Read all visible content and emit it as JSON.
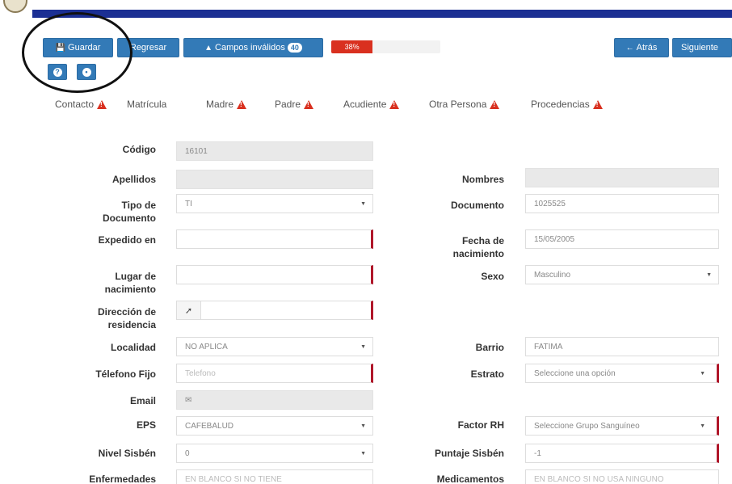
{
  "toolbar": {
    "save_label": "Guardar",
    "back_label": "Regresar",
    "invalid_label": "Campos inválidos",
    "invalid_count": "40",
    "progress_text": "38%",
    "progress_value": 0.38,
    "prev_label": "Atrás",
    "next_label": "Siguiente"
  },
  "tabs": [
    {
      "label": "Contacto",
      "warning": true
    },
    {
      "label": "Matrícula",
      "warning": false
    },
    {
      "label": "Madre",
      "warning": true
    },
    {
      "label": "Padre",
      "warning": true
    },
    {
      "label": "Acudiente",
      "warning": true
    },
    {
      "label": "Otra Persona",
      "warning": true
    },
    {
      "label": "Procedencias",
      "warning": true
    }
  ],
  "form": {
    "codigo": {
      "label": "Código",
      "value": "16101"
    },
    "apellidos": {
      "label": "Apellidos",
      "value": ""
    },
    "nombres": {
      "label": "Nombres",
      "value": ""
    },
    "tipo_documento": {
      "label": "Tipo de Documento",
      "value": "TI"
    },
    "documento": {
      "label": "Documento",
      "value": "1025525"
    },
    "expedido_en": {
      "label": "Expedido en",
      "value": ""
    },
    "fecha_nacimiento": {
      "label": "Fecha de nacimiento",
      "value": "15/05/2005"
    },
    "lugar_nacimiento": {
      "label": "Lugar de nacimiento",
      "value": ""
    },
    "sexo": {
      "label": "Sexo",
      "value": "Masculino"
    },
    "direccion": {
      "label": "Dirección de residencia",
      "value": ""
    },
    "localidad": {
      "label": "Localidad",
      "value": "NO APLICA"
    },
    "barrio": {
      "label": "Barrio",
      "value": "FATIMA"
    },
    "telefono": {
      "label": "Télefono Fijo",
      "placeholder": "Telefono"
    },
    "estrato": {
      "label": "Estrato",
      "value": "Seleccione una opción"
    },
    "email": {
      "label": "Email",
      "value": ""
    },
    "eps": {
      "label": "EPS",
      "value": "CAFEBALUD"
    },
    "factor_rh": {
      "label": "Factor RH",
      "value": "Seleccione Grupo Sanguíneo"
    },
    "nivel_sisben": {
      "label": "Nivel Sisbén",
      "value": "0"
    },
    "puntaje_sisben": {
      "label": "Puntaje Sisbén",
      "value": "-1"
    },
    "enfermedades": {
      "label": "Enfermedades",
      "placeholder": "EN BLANCO SI NO TIENE"
    },
    "medicamentos": {
      "label": "Medicamentos",
      "placeholder": "EN BLANCO SI NO USA NINGUNO"
    }
  },
  "colors": {
    "primary": "#337ab7",
    "danger": "#d9301f",
    "header": "#1b2f93"
  },
  "icons": {
    "save": "floppy-icon",
    "warning": "warning-triangle-icon",
    "help": "question-icon",
    "settings": "gear-icon",
    "back": "arrow-left-icon"
  }
}
